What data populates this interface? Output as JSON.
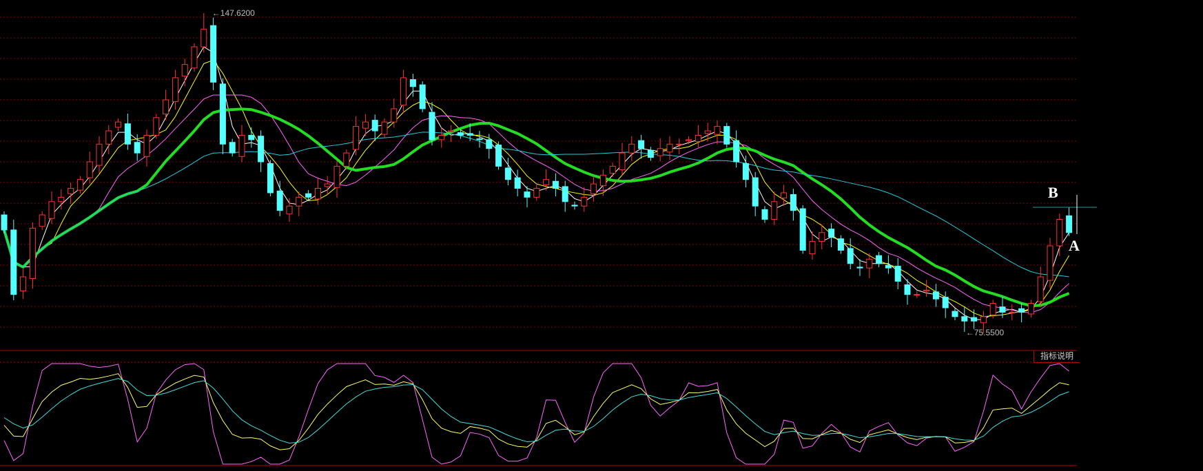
{
  "chart_data": {
    "type": "candlestick",
    "title": "",
    "close": [
      98.6,
      84,
      88,
      99,
      102,
      105,
      106,
      108,
      110,
      114,
      118,
      121,
      123,
      118,
      116,
      120,
      124,
      128,
      133,
      136,
      140,
      144,
      132,
      118,
      116,
      120,
      119,
      114,
      107,
      103,
      104,
      106,
      106,
      108,
      109,
      113,
      116,
      122,
      123,
      121,
      123,
      126,
      133,
      131,
      126,
      119,
      120,
      121,
      120,
      120,
      119,
      117,
      113,
      110,
      108,
      106,
      108,
      110,
      108,
      105,
      104,
      106,
      109,
      111,
      113,
      116,
      118,
      117,
      115,
      117,
      118,
      118,
      119,
      120,
      121,
      122,
      118,
      114,
      110,
      104,
      101,
      105,
      107,
      103,
      94,
      96,
      98,
      97,
      94,
      91,
      90,
      92,
      91,
      90,
      87,
      84,
      84,
      85,
      83,
      81,
      79,
      78,
      78,
      79,
      82,
      80,
      80,
      80,
      82,
      88,
      95,
      101,
      98
    ],
    "first_open": 102,
    "high_marker": {
      "index": 21,
      "value": 147.62,
      "label": "147.6200"
    },
    "low_marker": {
      "index": 101,
      "value": 75.55,
      "label": "75.5500"
    },
    "last_high": 103.8,
    "ylim": [
      70,
      148.5
    ],
    "moving_averages": [
      {
        "period": 3,
        "color": "#ffffff",
        "width": 1
      },
      {
        "period": 5,
        "color": "#ffff00",
        "width": 1
      },
      {
        "period": 10,
        "color": "#ff66ff",
        "width": 1
      },
      {
        "period": 15,
        "color": "#22dd22",
        "width": 4
      },
      {
        "period": 30,
        "color": "#22ccdd",
        "width": 1
      }
    ],
    "indicator": {
      "type": "KDJ",
      "period": 4,
      "ylim": [
        0,
        100
      ],
      "colors": {
        "K": "#ffff66",
        "D": "#44dddd",
        "J": "#ff66ff"
      }
    },
    "colors": {
      "up": "#ff3333",
      "down": "#54ffff",
      "grid": "#8b0000"
    }
  },
  "annotations": {
    "B": "B",
    "A": "A"
  },
  "indicator_help": "指标说明"
}
